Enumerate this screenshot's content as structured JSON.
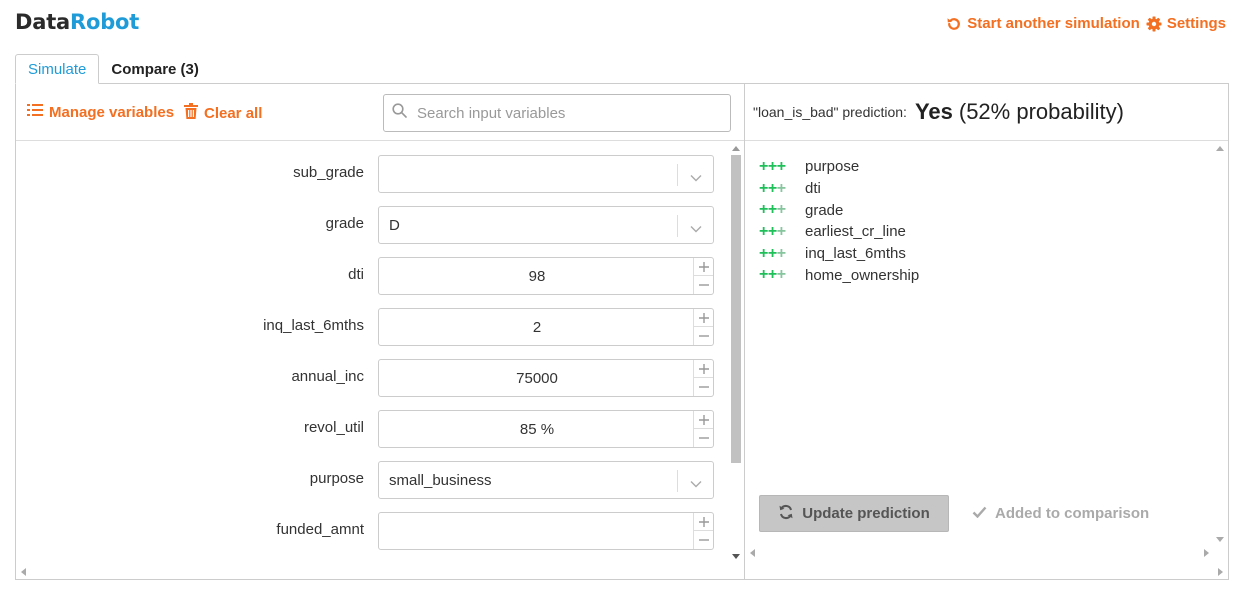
{
  "logo": {
    "part1": "Data",
    "part2": "Robot"
  },
  "top_actions": {
    "restart_label": "Start another simulation",
    "settings_label": "Settings"
  },
  "tabs": [
    {
      "label": "Simulate",
      "active": true
    },
    {
      "label": "Compare (3)",
      "active": false
    }
  ],
  "toolbar": {
    "manage_label": "Manage variables",
    "clear_label": "Clear all",
    "search_placeholder": "Search input variables"
  },
  "variables": [
    {
      "name": "sub_grade",
      "type": "select",
      "value": ""
    },
    {
      "name": "grade",
      "type": "select",
      "value": "D"
    },
    {
      "name": "dti",
      "type": "number",
      "value": "98"
    },
    {
      "name": "inq_last_6mths",
      "type": "number",
      "value": "2"
    },
    {
      "name": "annual_inc",
      "type": "number",
      "value": "75000"
    },
    {
      "name": "revol_util",
      "type": "number",
      "value": "85 %"
    },
    {
      "name": "purpose",
      "type": "select",
      "value": "small_business"
    },
    {
      "name": "funded_amnt",
      "type": "number",
      "value": ""
    }
  ],
  "prediction": {
    "label": "\"loan_is_bad\" prediction:",
    "answer": "Yes",
    "probability_text": "(52% probability)"
  },
  "explanations": [
    {
      "feature": "purpose",
      "strength": 3
    },
    {
      "feature": "dti",
      "strength": 2
    },
    {
      "feature": "grade",
      "strength": 2
    },
    {
      "feature": "earliest_cr_line",
      "strength": 2
    },
    {
      "feature": "inq_last_6mths",
      "strength": 2
    },
    {
      "feature": "home_ownership",
      "strength": 2
    }
  ],
  "actions": {
    "update_label": "Update prediction",
    "added_label": "Added to comparison"
  },
  "colors": {
    "accent_orange": "#f36f21",
    "brand_blue": "#1f9bd8",
    "positive_green": "#1fbf5a",
    "positive_green_light": "#86c59d"
  }
}
